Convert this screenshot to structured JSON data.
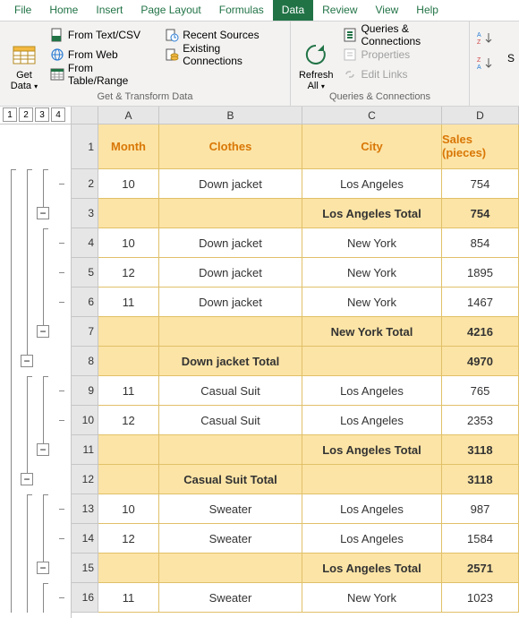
{
  "tabs": [
    "File",
    "Home",
    "Insert",
    "Page Layout",
    "Formulas",
    "Data",
    "Review",
    "View",
    "Help"
  ],
  "activeTab": "Data",
  "ribbon": {
    "getTransform": {
      "getData": "Get\nData",
      "items": [
        "From Text/CSV",
        "From Web",
        "From Table/Range",
        "Recent Sources",
        "Existing Connections"
      ],
      "label": "Get & Transform Data"
    },
    "queries": {
      "refresh": "Refresh\nAll",
      "items": [
        "Queries & Connections",
        "Properties",
        "Edit Links"
      ],
      "label": "Queries & Connections"
    },
    "sort": {
      "s": "S"
    }
  },
  "outlineLevels": [
    "1",
    "2",
    "3",
    "4"
  ],
  "columnLetters": [
    "A",
    "B",
    "C",
    "D"
  ],
  "headers": {
    "A": "Month",
    "B": "Clothes",
    "C": "City",
    "D": "Sales (pieces)"
  },
  "rows": [
    {
      "n": "2",
      "k": "data",
      "A": "10",
      "B": "Down jacket",
      "C": "Los Angeles",
      "D": "754"
    },
    {
      "n": "3",
      "k": "sub",
      "A": "",
      "B": "",
      "C": "Los Angeles Total",
      "D": "754"
    },
    {
      "n": "4",
      "k": "data",
      "A": "10",
      "B": "Down jacket",
      "C": "New York",
      "D": "854"
    },
    {
      "n": "5",
      "k": "data",
      "A": "12",
      "B": "Down jacket",
      "C": "New York",
      "D": "1895"
    },
    {
      "n": "6",
      "k": "data",
      "A": "11",
      "B": "Down jacket",
      "C": "New York",
      "D": "1467"
    },
    {
      "n": "7",
      "k": "sub",
      "A": "",
      "B": "",
      "C": "New York Total",
      "D": "4216"
    },
    {
      "n": "8",
      "k": "sub",
      "A": "",
      "B": "Down jacket Total",
      "C": "",
      "D": "4970"
    },
    {
      "n": "9",
      "k": "data",
      "A": "11",
      "B": "Casual Suit",
      "C": "Los Angeles",
      "D": "765"
    },
    {
      "n": "10",
      "k": "data",
      "A": "12",
      "B": "Casual Suit",
      "C": "Los Angeles",
      "D": "2353"
    },
    {
      "n": "11",
      "k": "sub",
      "A": "",
      "B": "",
      "C": "Los Angeles Total",
      "D": "3118"
    },
    {
      "n": "12",
      "k": "sub",
      "A": "",
      "B": "Casual Suit Total",
      "C": "",
      "D": "3118"
    },
    {
      "n": "13",
      "k": "data",
      "A": "10",
      "B": "Sweater",
      "C": "Los Angeles",
      "D": "987"
    },
    {
      "n": "14",
      "k": "data",
      "A": "12",
      "B": "Sweater",
      "C": "Los Angeles",
      "D": "1584"
    },
    {
      "n": "15",
      "k": "sub",
      "A": "",
      "B": "",
      "C": "Los Angeles Total",
      "D": "2571"
    },
    {
      "n": "16",
      "k": "data",
      "A": "11",
      "B": "Sweater",
      "C": "New York",
      "D": "1023"
    }
  ]
}
